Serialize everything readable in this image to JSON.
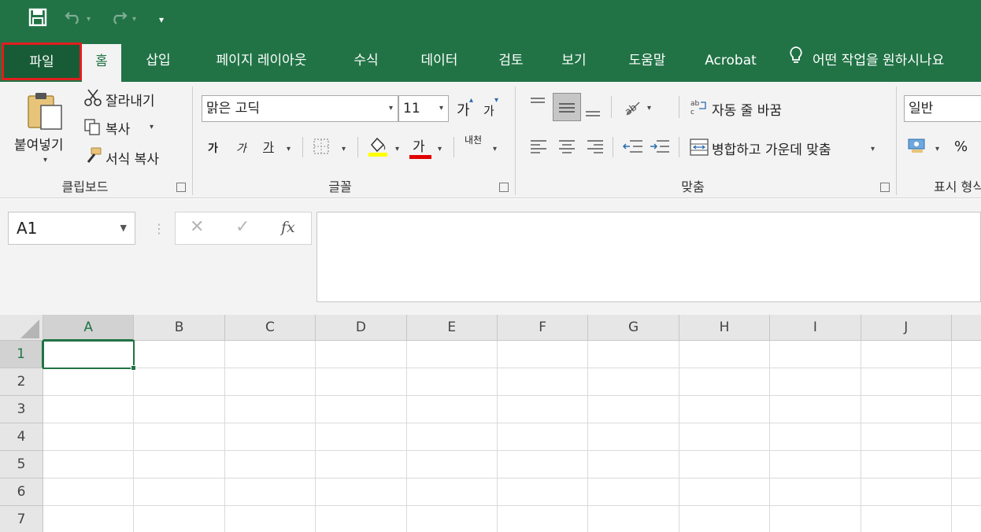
{
  "quick_access": {
    "save_icon": "save-icon",
    "undo_icon": "undo-icon",
    "redo_icon": "redo-icon",
    "customize_icon": "customize-qat-icon"
  },
  "tabs": [
    {
      "label": "파일"
    },
    {
      "label": "홈"
    },
    {
      "label": "삽입"
    },
    {
      "label": "페이지 레이아웃"
    },
    {
      "label": "수식"
    },
    {
      "label": "데이터"
    },
    {
      "label": "검토"
    },
    {
      "label": "보기"
    },
    {
      "label": "도움말"
    },
    {
      "label": "Acrobat"
    }
  ],
  "tell_me": {
    "label": "어떤 작업을 원하시나요"
  },
  "clipboard": {
    "paste_label": "붙여넣기",
    "cut_label": "잘라내기",
    "copy_label": "복사",
    "format_painter_label": "서식 복사",
    "group_label": "클립보드"
  },
  "font": {
    "font_name": "맑은 고딕",
    "font_size": "11",
    "grow_label": "가",
    "shrink_label": "가",
    "bold_label": "가",
    "italic_label": "가",
    "underline_label": "가",
    "font_color_label": "가",
    "phonetic_label": "내천",
    "group_label": "글꼴",
    "fill_color": "#ffff00",
    "font_color": "#e00000"
  },
  "alignment": {
    "wrap_text_label": "자동 줄 바꿈",
    "merge_label": "병합하고 가운데 맞춤",
    "group_label": "맞춤"
  },
  "number": {
    "format": "일반",
    "percent_label": "%",
    "group_label": "표시 형식"
  },
  "formula_bar": {
    "name_box": "A1",
    "cancel_symbol": "✕",
    "enter_symbol": "✓",
    "fx_label": "fx",
    "content": ""
  },
  "grid": {
    "columns": [
      "A",
      "B",
      "C",
      "D",
      "E",
      "F",
      "G",
      "H",
      "I",
      "J"
    ],
    "rows": [
      "1",
      "2",
      "3",
      "4",
      "5",
      "6",
      "7"
    ],
    "active_cell": "A1"
  },
  "colors": {
    "excel_green": "#217346",
    "highlight_box": "#e01e1e"
  }
}
